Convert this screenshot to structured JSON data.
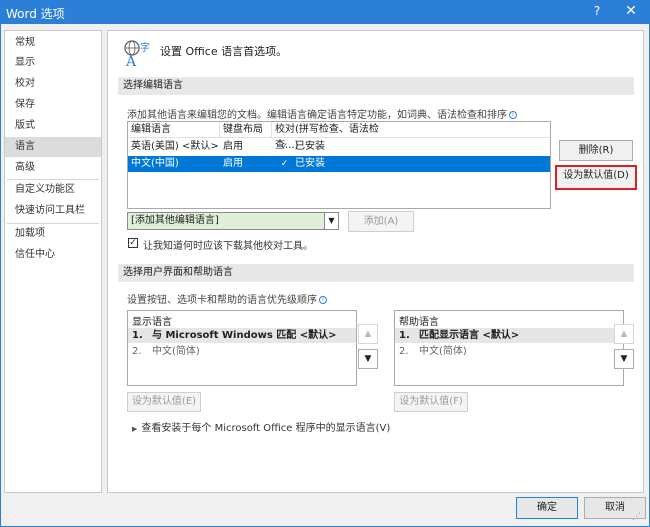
{
  "window": {
    "title": "Word 选项",
    "help": "?",
    "close": "✕"
  },
  "sidebar": {
    "items": [
      "常规",
      "显示",
      "校对",
      "保存",
      "版式",
      "语言",
      "高级",
      "自定义功能区",
      "快速访问工具栏",
      "加载项",
      "信任中心"
    ]
  },
  "main": {
    "page_title": "设置 Office 语言首选项。",
    "editing": {
      "section": "选择编辑语言",
      "description": "添加其他语言来编辑您的文档。编辑语言确定语言特定功能，如词典、语法检查和排序",
      "columns": [
        "编辑语言",
        "键盘布局",
        "校对(拼写检查、语法检查...)"
      ],
      "rows": [
        {
          "language": "英语(美国) <默认>",
          "keyboard": "启用",
          "proofing": "已安装"
        },
        {
          "language": "中文(中国)",
          "keyboard": "启用",
          "proofing": "已安装"
        }
      ],
      "remove_button": "删除(R)",
      "set_default_button": "设为默认值(D)",
      "add_combo": "[添加其他编辑语言]",
      "add_button": "添加(A)",
      "checkbox_label": "让我知道何时应该下载其他校对工具。"
    },
    "ui": {
      "section": "选择用户界面和帮助语言",
      "description": "设置按钮、选项卡和帮助的语言优先级顺序",
      "display": {
        "title": "显示语言",
        "items": [
          {
            "num": "1.",
            "text": "与 Microsoft Windows 匹配 <默认>"
          },
          {
            "num": "2.",
            "text": "中文(简体)"
          }
        ],
        "set_default_button": "设为默认值(E)"
      },
      "help": {
        "title": "帮助语言",
        "items": [
          {
            "num": "1.",
            "text": "匹配显示语言 <默认>"
          },
          {
            "num": "2.",
            "text": "中文(简体)"
          }
        ],
        "set_default_button": "设为默认值(F)"
      },
      "expander": "查看安装于每个 Microsoft Office 程序中的显示语言(V)"
    }
  },
  "footer": {
    "ok": "确定",
    "cancel": "取消"
  }
}
